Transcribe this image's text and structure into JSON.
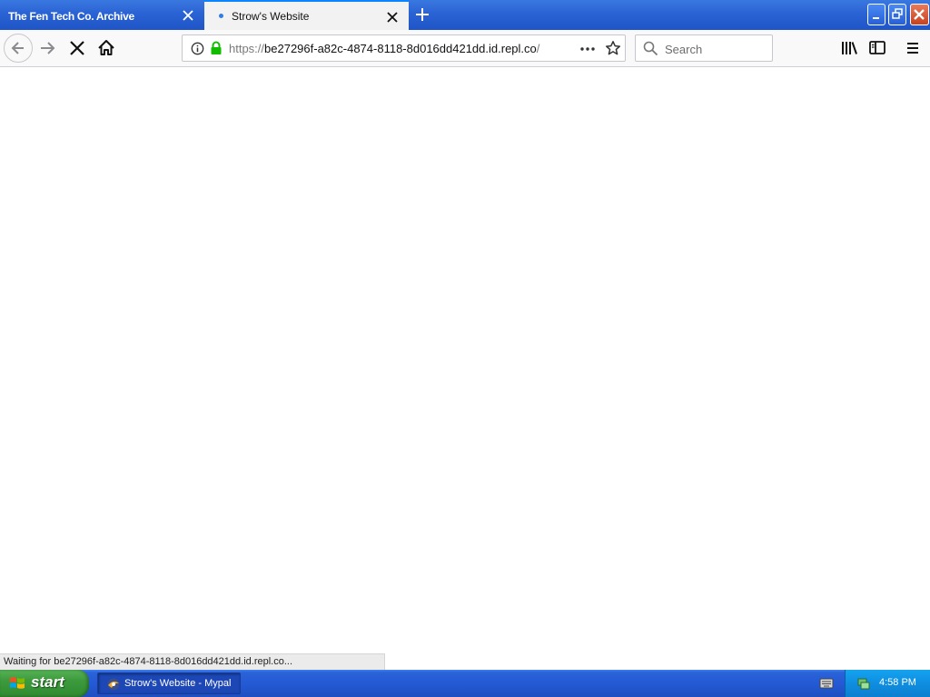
{
  "tabs": [
    {
      "title": "The Fen Tech Co. Archive",
      "active": false
    },
    {
      "title": "Strow's Website",
      "active": true,
      "loading": true
    }
  ],
  "urlbar": {
    "scheme": "https://",
    "host": "be27296f-a82c-4874-8118-8d016dd421dd.id.repl.co",
    "path": "/"
  },
  "search": {
    "placeholder": "Search"
  },
  "status": {
    "text": "Waiting for be27296f-a82c-4874-8118-8d016dd421dd.id.repl.co..."
  },
  "taskbar": {
    "start_label": "start",
    "task_label": "Strow's Website - Mypal",
    "clock": "4:58 PM"
  },
  "colors": {
    "accent": "#0a84ff",
    "secure": "#12bc00",
    "taskbar": "#245ad4",
    "start": "#3c9a3c"
  }
}
